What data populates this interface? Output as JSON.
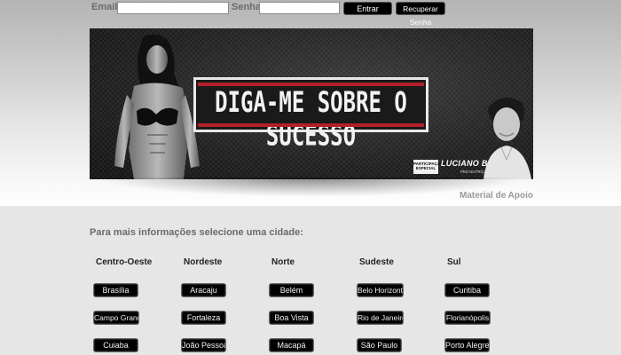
{
  "login": {
    "email_label": "Email:",
    "email_value": "",
    "senha_label": "Senha:",
    "senha_value": "",
    "enter_button": "Entrar",
    "recover_button": "Recuperar Senha"
  },
  "banner": {
    "title": "DIGA-ME SOBRE O SUCESSO",
    "special_tag": "PARTICIPAÇÃO ESPECIAL",
    "guest_name": "LUCIANO BRUNO",
    "guest_subtitle": "PhD NUTRIÇÃO"
  },
  "material_link": "Material de Apoio",
  "section_title": "Para mais informações selecione uma cidade:",
  "regions": [
    {
      "name": "Centro-Oeste",
      "cities": [
        "Brasília",
        "Campo Grande",
        "Cuiaba"
      ]
    },
    {
      "name": "Nordeste",
      "cities": [
        "Aracaju",
        "Fortaleza",
        "João Pessoa"
      ]
    },
    {
      "name": "Norte",
      "cities": [
        "Belém",
        "Boa Vista",
        "Macapá"
      ]
    },
    {
      "name": "Sudeste",
      "cities": [
        "Belo Horizonte",
        "Rio de Janeiro",
        "São Paulo"
      ]
    },
    {
      "name": "Sul",
      "cities": [
        "Curitiba",
        "Florianópolis",
        "Porto Alegre"
      ]
    }
  ],
  "colors": {
    "button_bg": "#000000",
    "accent_red": "#b3202a",
    "label_gray": "#6b6b6b"
  }
}
